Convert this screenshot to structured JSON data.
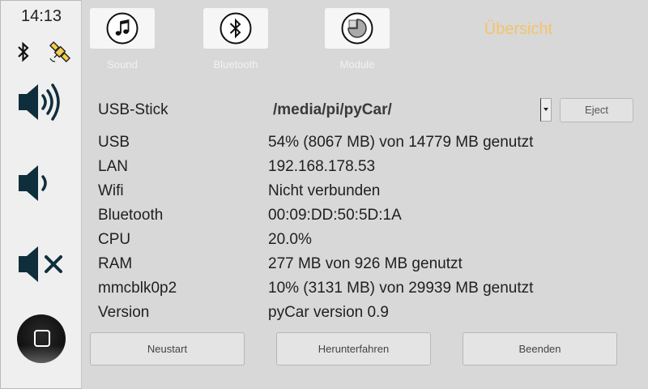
{
  "sidebar": {
    "clock": "14:13",
    "status_icons": [
      "bluetooth-icon",
      "gps-satellite-icon"
    ],
    "volume_buttons": [
      "volume-up-icon",
      "volume-down-icon",
      "volume-mute-icon"
    ],
    "home_icon": "home-square-icon"
  },
  "top_nav": {
    "buttons": [
      {
        "label": "Sound",
        "icon": "music-note-icon"
      },
      {
        "label": "Bluetooth",
        "icon": "bluetooth-icon"
      },
      {
        "label": "Module",
        "icon": "module-icon"
      }
    ],
    "title": "Übersicht",
    "title_color": "#f3c36a"
  },
  "usb": {
    "label": "USB-Stick",
    "selected_path": "/media/pi/pyCar/",
    "eject_label": "Eject"
  },
  "info_rows": [
    {
      "key": "USB",
      "value": "54% (8067 MB) von 14779 MB genutzt"
    },
    {
      "key": "LAN",
      "value": "192.168.178.53"
    },
    {
      "key": "Wifi",
      "value": "Nicht verbunden"
    },
    {
      "key": "Bluetooth",
      "value": "00:09:DD:50:5D:1A"
    },
    {
      "key": "CPU",
      "value": "20.0%"
    },
    {
      "key": "RAM",
      "value": "277 MB von 926 MB genutzt"
    },
    {
      "key": "mmcblk0p2",
      "value": "10% (3131 MB) von 29939 MB genutzt"
    },
    {
      "key": "Version",
      "value": "pyCar version 0.9"
    }
  ],
  "actions": {
    "restart": "Neustart",
    "shutdown": "Herunterfahren",
    "quit": "Beenden"
  }
}
